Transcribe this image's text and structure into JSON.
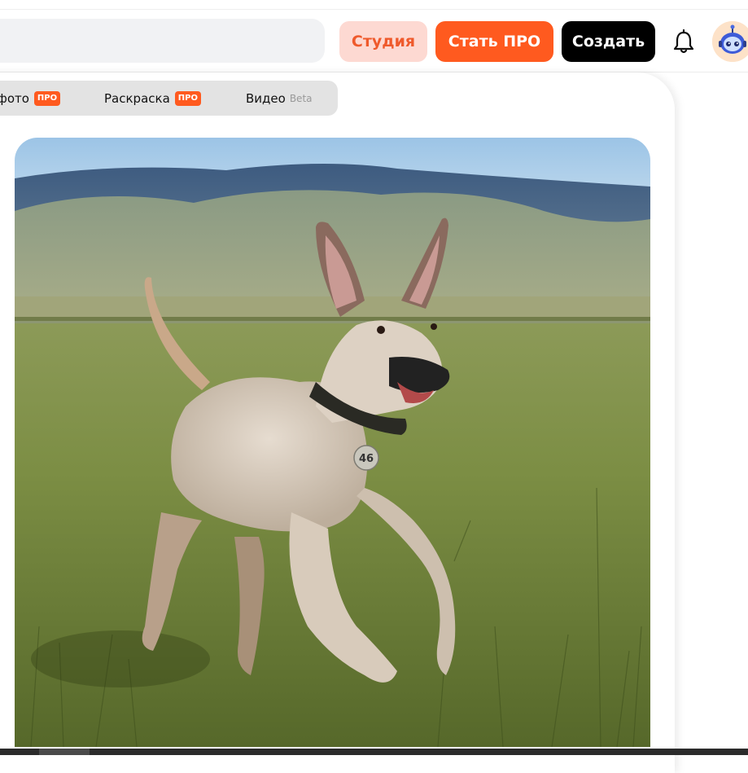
{
  "header": {
    "studio_label": "Студия",
    "pro_label": "Стать ПРО",
    "create_label": "Создать"
  },
  "tabs": [
    {
      "label": "фото",
      "badge": "ПРО"
    },
    {
      "label": "Раскраска",
      "badge": "ПРО"
    },
    {
      "label": "Видео",
      "badge": "Beta"
    }
  ],
  "image": {
    "tag_text": "46"
  },
  "colors": {
    "accent": "#ff5a1f",
    "studio_bg": "#fdd9d2",
    "create_bg": "#000000"
  },
  "icons": [
    "bell-icon",
    "robot-avatar-icon"
  ]
}
